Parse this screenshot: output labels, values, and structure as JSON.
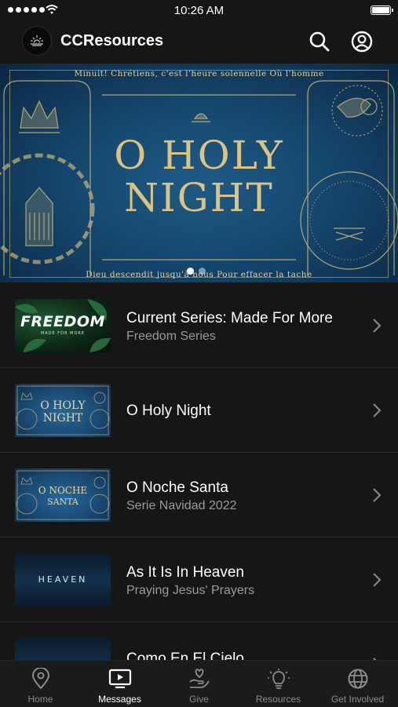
{
  "status": {
    "time": "10:26 AM"
  },
  "header": {
    "title": "CCResources"
  },
  "hero": {
    "top_text": "Minuit! Chrétiens, c'est l'heure solennelle Où l'homme",
    "title_line1": "O HOLY",
    "title_line2": "NIGHT",
    "bottom_text": "Dieu descendit jusqu'à nous Pour effacer la tache",
    "active_slide": 1,
    "slide_count": 2
  },
  "thumbs": {
    "freedom": "FREEDOM",
    "freedom_sub": "MADE FOR MORE",
    "holy_1": "O HOLY",
    "holy_2": "NIGHT",
    "noche_1": "O NOCHE",
    "noche_2": "SANTA",
    "heaven": "HEAVEN"
  },
  "items": [
    {
      "title": "Current Series: Made For More",
      "subtitle": "Freedom Series"
    },
    {
      "title": "O Holy Night",
      "subtitle": ""
    },
    {
      "title": "O Noche Santa",
      "subtitle": "Serie Navidad 2022"
    },
    {
      "title": "As It Is In Heaven",
      "subtitle": "Praying Jesus' Prayers"
    },
    {
      "title": "Como En El Cielo",
      "subtitle": ""
    }
  ],
  "tabs": [
    {
      "label": "Home",
      "icon": "location-pin-icon"
    },
    {
      "label": "Messages",
      "icon": "tv-play-icon"
    },
    {
      "label": "Give",
      "icon": "hand-heart-icon"
    },
    {
      "label": "Resources",
      "icon": "lightbulb-icon"
    },
    {
      "label": "Get Involved",
      "icon": "globe-icon"
    }
  ],
  "active_tab": "Messages",
  "colors": {
    "accent_gold": "#dcc382",
    "background": "#161616",
    "hero_blue": "#1a4e78"
  }
}
